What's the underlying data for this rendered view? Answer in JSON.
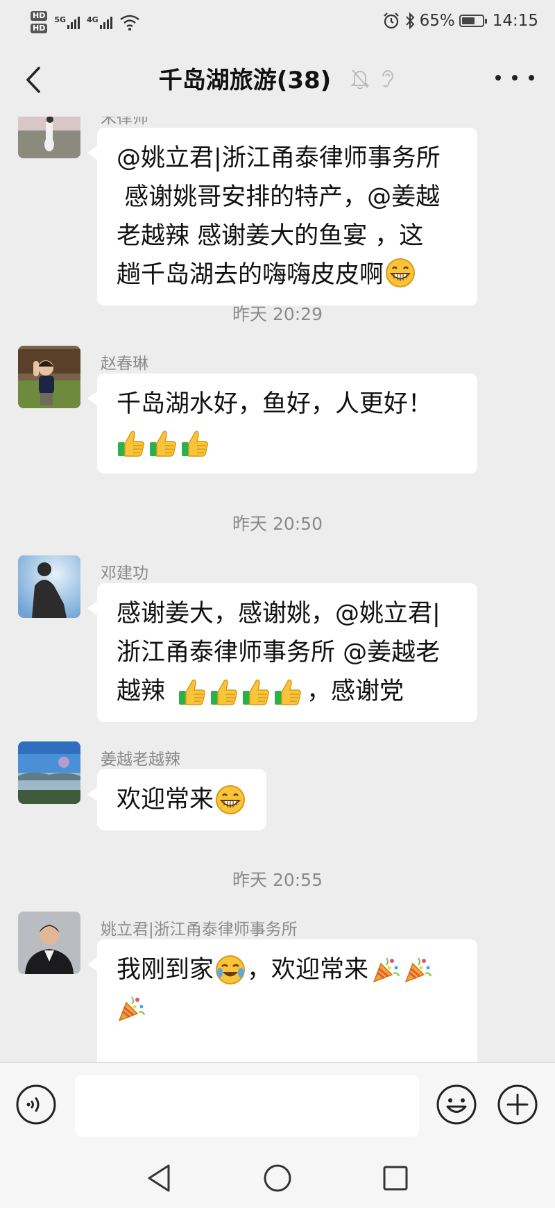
{
  "status_bar": {
    "hd1": "HD",
    "hd2": "HD",
    "network1": "5G",
    "network2": "4G",
    "battery_percent": "65%",
    "battery_level": 0.65,
    "time": "14:15"
  },
  "header": {
    "title": "千岛湖旅游(38)"
  },
  "messages": [
    {
      "sender": "宋律师",
      "lines": [
        "@姚立君|浙江甬泰律师事务所",
        " 感谢姚哥安排的特产，@姜越",
        "老越辣  感谢姜大的鱼宴 ，这",
        "趟千岛湖去的嗨嗨皮皮啊"
      ]
    },
    {
      "time": "昨天 20:29"
    },
    {
      "sender": "赵春琳",
      "lines": [
        "千岛湖水好，鱼好，人更好！"
      ]
    },
    {
      "time": "昨天 20:50"
    },
    {
      "sender": "邓建功",
      "lines": [
        "感谢姜大，感谢姚，@姚立君|",
        "浙江甬泰律师事务所 @姜越老",
        "越辣",
        "，感谢党"
      ]
    },
    {
      "sender": "姜越老越辣",
      "lines": [
        "欢迎常来"
      ]
    },
    {
      "time": "昨天 20:55"
    },
    {
      "sender": "姚立君|浙江甬泰律师事务所",
      "lines": [
        "我刚到家",
        "，欢迎常来"
      ]
    }
  ],
  "input": {
    "placeholder": ""
  },
  "colors": {
    "background": "#ededed",
    "bubble": "#ffffff",
    "meta_text": "#8a8a8a",
    "emoji_yellow": "#f8c53a",
    "thumb_sleeve": "#2bb04a"
  },
  "icons": {
    "back": "chevron-left-icon",
    "mute": "bell-off-icon",
    "ear": "ear-icon",
    "more": "more-dots-icon",
    "voice": "voice-icon",
    "emoji": "emoji-icon",
    "plus": "plus-icon",
    "sys_back": "triangle-back-icon",
    "sys_home": "circle-home-icon",
    "sys_recent": "square-recent-icon"
  }
}
